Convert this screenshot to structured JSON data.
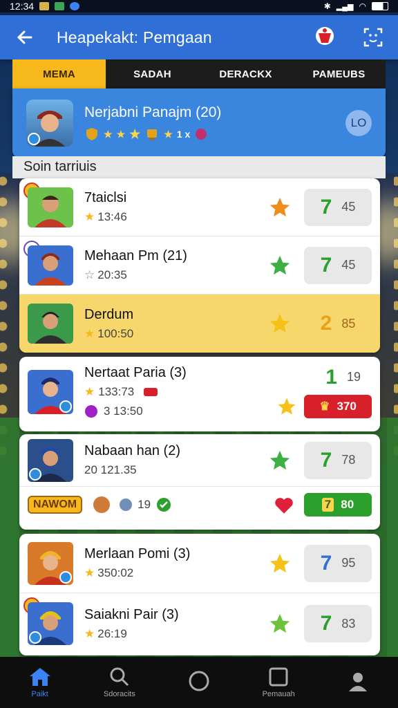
{
  "status": {
    "time": "12:34"
  },
  "header": {
    "title": "Heapekakt: Pemgaan"
  },
  "tabs": [
    "MEMA",
    "SADAH",
    "DERACKX",
    "PAMEUBS"
  ],
  "profile": {
    "name": "Nerjabni Panajm (20)",
    "badge_text": "1 x",
    "action": "LO"
  },
  "section_label": "Soin tarriuis",
  "rows": [
    {
      "name": "7taiclsi",
      "time": "13:46",
      "score_big": "7",
      "score_small": "45"
    },
    {
      "name": "Mehaan Pm (21)",
      "time": "20:35",
      "score_big": "7",
      "score_small": "45"
    },
    {
      "name": "Derdum",
      "time": "100:50",
      "score_big": "2",
      "score_small": "85"
    }
  ],
  "card3": {
    "name": "Nertaat Paria (3)",
    "time": "133:73",
    "time2": "3 13:50",
    "score_big": "1",
    "score_small": "19",
    "chip_text": "370"
  },
  "card4": {
    "name": "Nabaan han (2)",
    "time": "20 121.35",
    "tag": "NAWOM",
    "count": "19",
    "score_big": "7",
    "score_small": "78",
    "chip_big": "7",
    "chip_small": "80"
  },
  "card5": [
    {
      "name": "Merlaan Pomi (3)",
      "time": "350:02",
      "score_big": "7",
      "score_small": "95"
    },
    {
      "name": "Saiakni Pair (3)",
      "time": "26:19",
      "score_big": "7",
      "score_small": "83"
    }
  ],
  "nav": [
    "Paikt",
    "Sdoracits",
    "",
    "Pemauah",
    ""
  ],
  "colors": {
    "accent": "#2f6fd6",
    "tab_active": "#f6b81a",
    "highlight": "#f7d76b",
    "green": "#2ca02c",
    "red": "#d8202a"
  }
}
